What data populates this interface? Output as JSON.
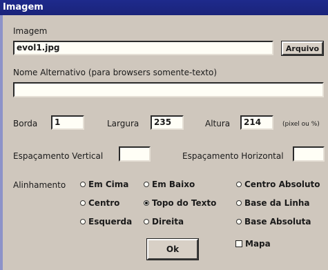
{
  "window": {
    "title": "Imagem"
  },
  "image": {
    "label": "Imagem",
    "value": "evol1.jpg",
    "browse_button": "Arquivo"
  },
  "alt_text": {
    "label": "Nome Alternativo (para browsers somente-texto)",
    "value": ""
  },
  "border": {
    "label": "Borda",
    "value": "1"
  },
  "width": {
    "label": "Largura",
    "value": "235"
  },
  "height": {
    "label": "Altura",
    "value": "214"
  },
  "units_note": "(pixel ou %)",
  "vspace": {
    "label": "Espaçamento Vertical",
    "value": ""
  },
  "hspace": {
    "label": "Espaçamento Horizontal",
    "value": ""
  },
  "alignment": {
    "label": "Alinhamento",
    "selected": "Topo do Texto",
    "options": [
      "Em Cima",
      "Em Baixo",
      "Centro Absoluto",
      "Centro",
      "Topo do Texto",
      "Base da Linha",
      "Esquerda",
      "Direita",
      "Base Absoluta"
    ]
  },
  "ok_button": "Ok",
  "map_checkbox": {
    "label": "Mapa",
    "checked": false
  }
}
